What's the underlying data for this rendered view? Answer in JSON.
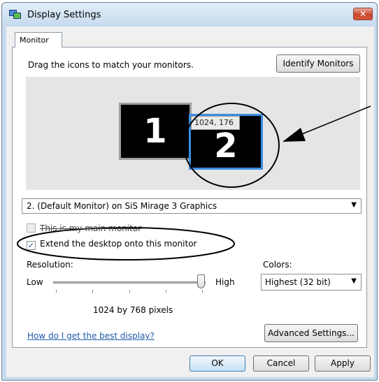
{
  "window": {
    "title": "Display Settings",
    "close_label": "✕"
  },
  "tabs": [
    {
      "label": "Monitor"
    }
  ],
  "monitor_panel": {
    "instruction": "Drag the icons to match your monitors.",
    "identify_button": "Identify Monitors",
    "monitor_1_label": "1",
    "monitor_2_label": "2",
    "position_tooltip": "1024, 176",
    "monitor_select_value": "2. (Default Monitor) on SiS Mirage 3 Graphics",
    "main_monitor_checkbox": {
      "label": "This is my main monitor",
      "checked": false,
      "enabled": false
    },
    "extend_checkbox": {
      "label": "Extend the desktop onto this monitor",
      "checked": true
    },
    "resolution": {
      "label": "Resolution:",
      "low_label": "Low",
      "high_label": "High",
      "value_text": "1024 by 768 pixels",
      "slider_level": 1.0
    },
    "colors": {
      "label": "Colors:",
      "selected": "Highest (32 bit)"
    },
    "help_link": "How do I get the best display?",
    "advanced_button": "Advanced Settings..."
  },
  "footer": {
    "ok_label": "OK",
    "cancel_label": "Cancel",
    "apply_label": "Apply"
  },
  "colors": {
    "accent": "#3b8de0",
    "link": "#1e5aa8",
    "close_red": "#c9462c"
  }
}
